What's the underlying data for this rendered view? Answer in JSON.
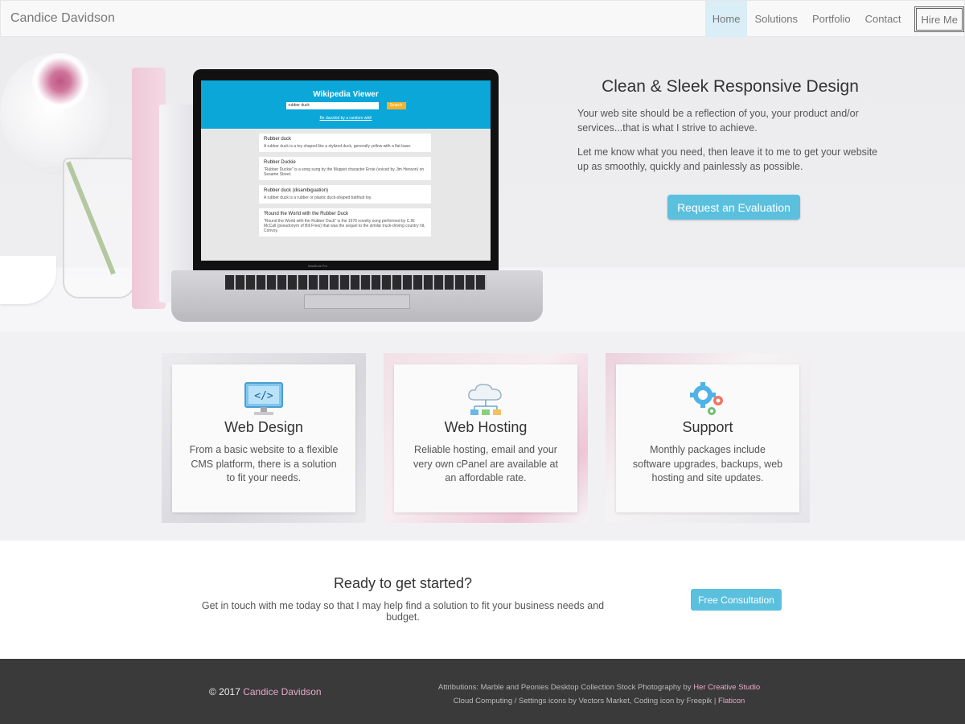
{
  "navbar": {
    "brand": "Candice Davidson",
    "items": [
      {
        "label": "Home"
      },
      {
        "label": "Solutions"
      },
      {
        "label": "Portfolio"
      },
      {
        "label": "Contact"
      }
    ],
    "hire": "Hire Me",
    "active_color": "#d9eef6"
  },
  "hero": {
    "title": "Clean & Sleek Responsive Design",
    "p1": "Your web site should be a reflection of you, your product and/or services...that is what I strive to achieve.",
    "p2": "Let me know what you need, then leave it to me to get your website up as smoothly, quickly and painlessly as possible.",
    "button": "Request an Evaluation",
    "laptop": {
      "app_title": "Wikipedia Viewer",
      "search_value": "rubber duck",
      "search_button": "Search",
      "random_link": "Be dazzled by a random wiki!",
      "brand": "MacBook Pro",
      "results": [
        {
          "title": "Rubber duck",
          "text": "A rubber duck is a toy shaped like a stylized duck, generally yellow with a flat base."
        },
        {
          "title": "Rubber Duckie",
          "text": "\"Rubber Duckie\" is a song sung by the Muppet character Ernie (voiced by Jim Henson) on Sesame Street."
        },
        {
          "title": "Rubber duck (disambiguation)",
          "text": "A rubber duck is a rubber or plastic duck-shaped bathtub toy."
        },
        {
          "title": "'Round the World with the Rubber Duck",
          "text": "\"Round the World with the Rubber Duck\" is the 1976 novelty song performed by C.W. McCall (pseudonym of Bill Fries) that was the sequel to the similar truck-driving country hit, Convoy."
        }
      ]
    }
  },
  "services": [
    {
      "icon": "code-monitor-icon",
      "title": "Web Design",
      "text": "From a basic website to a flexible CMS platform, there is a solution to fit your needs."
    },
    {
      "icon": "cloud-network-icon",
      "title": "Web Hosting",
      "text": "Reliable hosting, email and your very own cPanel are available at an affordable rate."
    },
    {
      "icon": "gears-icon",
      "title": "Support",
      "text": "Monthly packages include software upgrades, backups, web hosting and site updates."
    }
  ],
  "cta": {
    "title": "Ready to get started?",
    "text": "Get in touch with me today so that I may help find a solution to fit your business needs and budget.",
    "button": "Free Consultation"
  },
  "footer": {
    "copyright_prefix": "© 2017",
    "copyright_name": "Candice Davidson",
    "attr_line1_prefix": "Attributions: Marble and Peonies Desktop Collection Stock Photography by",
    "attr_line1_link": "Her Creative Studio",
    "attr_line2_prefix": "Cloud Computing / Settings icons by Vectors Market, Coding icon by Freepik |",
    "attr_line2_link": "Flaticon"
  },
  "colors": {
    "accent": "#5bc0de",
    "footer_bg": "#3a3a3a",
    "footer_link": "#e6a9c9"
  }
}
